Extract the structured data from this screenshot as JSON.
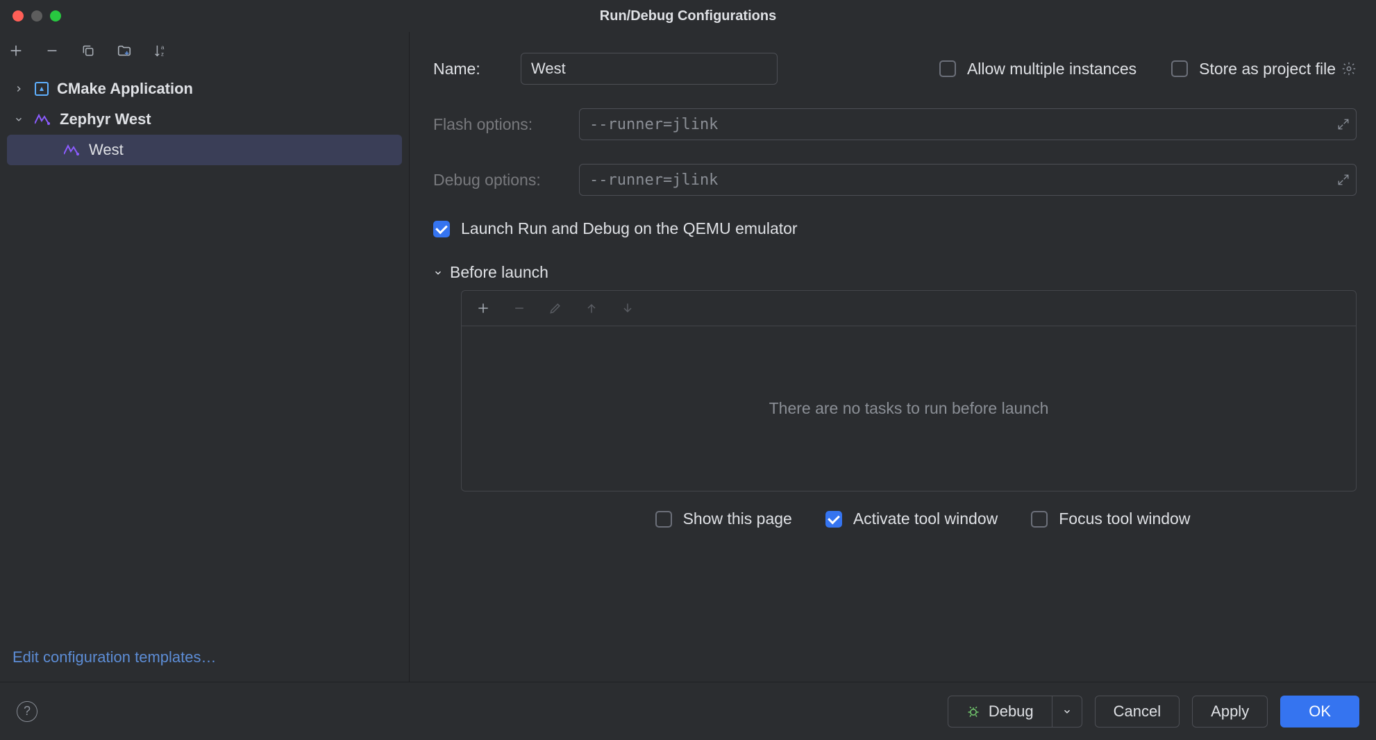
{
  "window": {
    "title": "Run/Debug Configurations"
  },
  "toolbar": {
    "add": "Add",
    "remove": "Remove",
    "copy": "Copy",
    "folder": "Folder",
    "sort": "Sort"
  },
  "tree": {
    "cmake": {
      "label": "CMake Application"
    },
    "zephyr": {
      "label": "Zephyr West"
    },
    "west": {
      "label": "West"
    }
  },
  "sidebar": {
    "edit_templates": "Edit configuration templates…"
  },
  "form": {
    "name_label": "Name:",
    "name_value": "West",
    "allow_multiple": "Allow multiple instances",
    "store_project": "Store as project file",
    "flash_label": "Flash options:",
    "flash_value": "--runner=jlink",
    "debug_label": "Debug options:",
    "debug_value": "--runner=jlink",
    "qemu": "Launch Run and Debug on the QEMU emulator",
    "before_launch": "Before launch",
    "no_tasks": "There are no tasks to run before launch",
    "show_page": "Show this page",
    "activate_tool": "Activate tool window",
    "focus_tool": "Focus tool window"
  },
  "footer": {
    "debug": "Debug",
    "cancel": "Cancel",
    "apply": "Apply",
    "ok": "OK"
  }
}
